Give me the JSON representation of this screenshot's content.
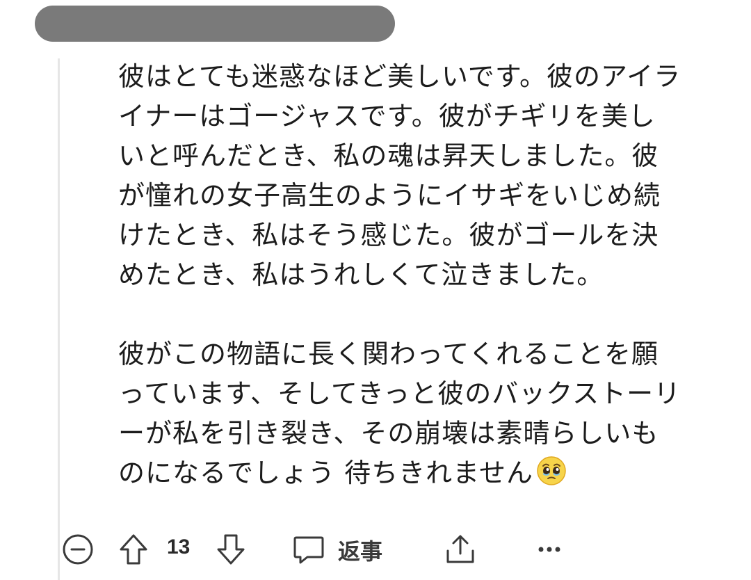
{
  "comment": {
    "paragraphs": [
      "彼はとても迷惑なほど美しいです。彼のアイライナーはゴージャスです。彼がチギリを美しいと呼んだとき、私の魂は昇天しました。彼が憧れの女子高生のようにイサギをいじめ続けたとき、私はそう感じた。彼がゴールを決めたとき、私はうれしくて泣きました。",
      "彼がこの物語に長く関わってくれることを願っています、そしてきっと彼のバックストーリーが私を引き裂き、その崩壊は素晴らしいものになるでしょう 待ちきれません"
    ],
    "emoji": "pleading-face-emoji"
  },
  "actions": {
    "vote_count": "13",
    "reply_label": "返事",
    "icons": {
      "collapse": "collapse-minus-icon",
      "upvote": "upvote-arrow-icon",
      "downvote": "downvote-arrow-icon",
      "reply": "speech-bubble-icon",
      "share": "share-icon",
      "more": "more-dots-icon"
    }
  },
  "colors": {
    "redaction": "#7a7a7a",
    "thread_line": "#e6e6e6",
    "icon": "#3a3a3a"
  }
}
